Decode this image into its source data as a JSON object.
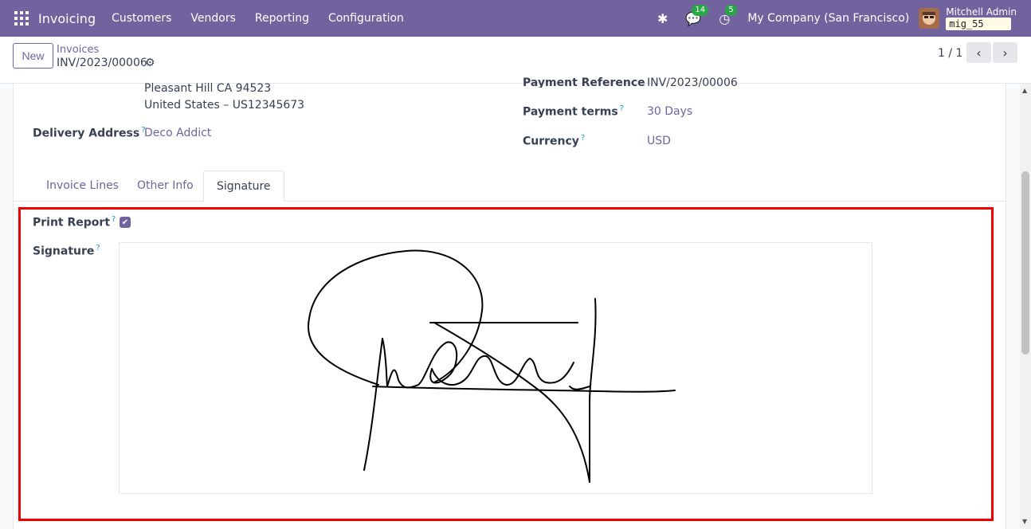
{
  "navbar": {
    "app_name": "Invoicing",
    "menu": [
      "Customers",
      "Vendors",
      "Reporting",
      "Configuration"
    ],
    "messages_count": "14",
    "activities_count": "5",
    "company": "My Company (San Francisco)",
    "user_name": "Mitchell Admin",
    "database": "mig_55"
  },
  "control": {
    "new_label": "New",
    "breadcrumb_parent": "Invoices",
    "breadcrumb_current": "INV/2023/00006",
    "pager": "1 / 1"
  },
  "form": {
    "address_line1": "Pleasant Hill CA 94523",
    "address_line2": "United States – US12345673",
    "delivery_address_label": "Delivery Address",
    "delivery_address_value": "Deco Addict",
    "payment_reference_label": "Payment Reference",
    "payment_reference_value": "INV/2023/00006",
    "payment_terms_label": "Payment terms",
    "payment_terms_value": "30 Days",
    "currency_label": "Currency",
    "currency_value": "USD",
    "help_mark": "?"
  },
  "tabs": [
    "Invoice Lines",
    "Other Info",
    "Signature"
  ],
  "signature_tab": {
    "print_report_label": "Print Report",
    "print_report_checked": true,
    "signature_label": "Signature"
  },
  "colors": {
    "brand": "#71639e",
    "highlight": "#ee0000",
    "help": "#17a2b8"
  }
}
